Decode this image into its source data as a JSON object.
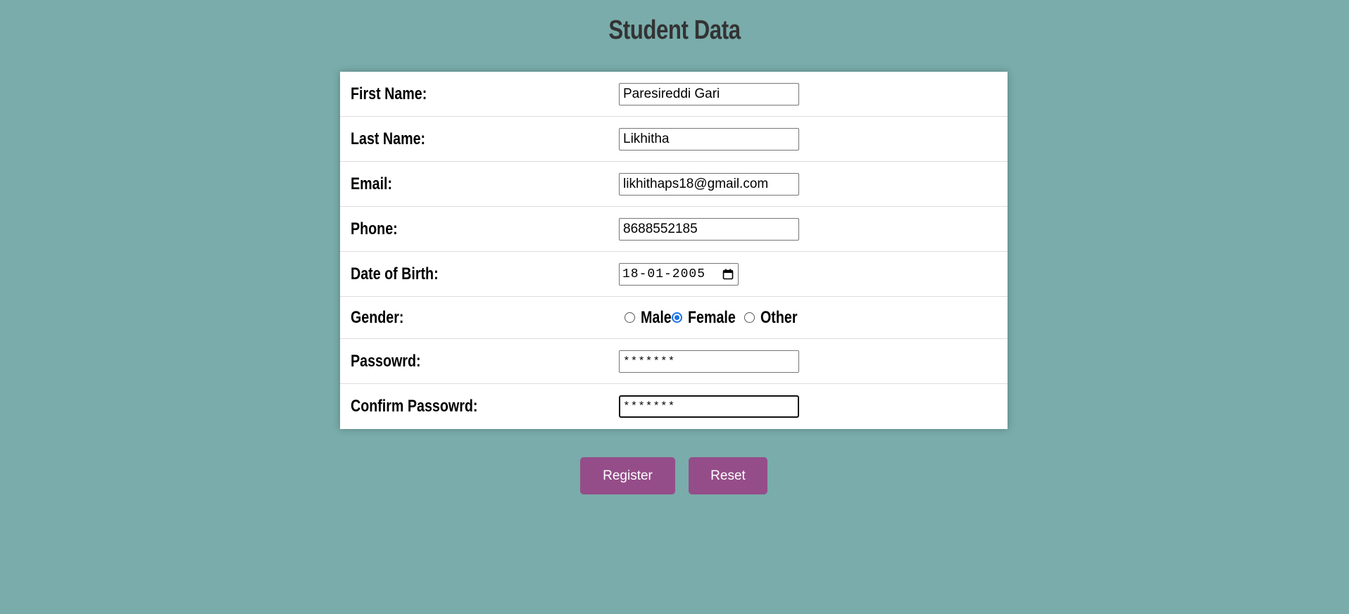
{
  "title": "Student Data",
  "form": {
    "first_name": {
      "label": "First Name:",
      "value": "Paresireddi Gari"
    },
    "last_name": {
      "label": "Last Name:",
      "value": "Likhitha"
    },
    "email": {
      "label": "Email:",
      "value": "likhithaps18@gmail.com"
    },
    "phone": {
      "label": "Phone:",
      "value": "8688552185"
    },
    "dob": {
      "label": "Date of Birth:",
      "value": "18-01-2005",
      "icon": "calendar-icon"
    },
    "gender": {
      "label": "Gender:",
      "options": [
        {
          "label": "Male",
          "checked": false
        },
        {
          "label": "Female",
          "checked": true
        },
        {
          "label": "Other",
          "checked": false
        }
      ]
    },
    "password": {
      "label": "Passowrd:",
      "value": "*******"
    },
    "confirm_password": {
      "label": "Confirm Passowrd:",
      "value": "*******"
    }
  },
  "buttons": {
    "register": "Register",
    "reset": "Reset"
  },
  "colors": {
    "background": "#79acab",
    "button": "#954d89",
    "radio_checked": "#1a73e8"
  }
}
